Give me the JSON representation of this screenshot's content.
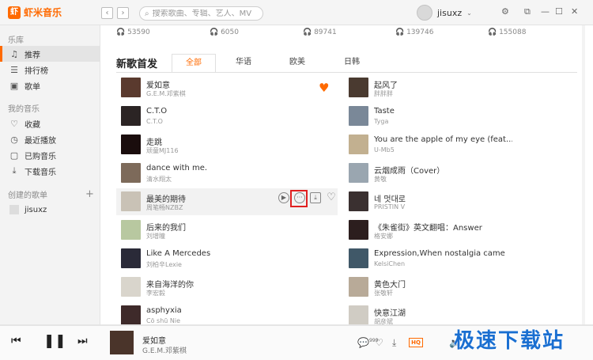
{
  "app": {
    "name": "虾米音乐",
    "logo_glyph": "虾"
  },
  "search": {
    "placeholder": "搜索歌曲、专辑、艺人、MV"
  },
  "user": {
    "name": "jisuxz"
  },
  "sidebar": {
    "library_label": "乐库",
    "library": [
      {
        "label": "推荐",
        "icon": "music-note-icon",
        "active": true
      },
      {
        "label": "排行榜",
        "icon": "chart-icon"
      },
      {
        "label": "歌单",
        "icon": "playlist-icon"
      }
    ],
    "my_music_label": "我的音乐",
    "my_music": [
      {
        "label": "收藏",
        "icon": "heart-icon"
      },
      {
        "label": "最近播放",
        "icon": "clock-icon"
      },
      {
        "label": "已购音乐",
        "icon": "bag-icon"
      },
      {
        "label": "下载音乐",
        "icon": "download-icon"
      }
    ],
    "created_label": "创建的歌单",
    "created": [
      {
        "label": "jisuxz"
      }
    ]
  },
  "stats": [
    "53590",
    "6050",
    "89741",
    "139746",
    "155088"
  ],
  "section": {
    "title": "新歌首发"
  },
  "tabs": [
    {
      "label": "全部",
      "active": true
    },
    {
      "label": "华语"
    },
    {
      "label": "欧美"
    },
    {
      "label": "日韩"
    }
  ],
  "songs_left": [
    {
      "title": "爱如意",
      "artist": "G.E.M.邓紫棋",
      "color": "#5a3a2e",
      "liked": true
    },
    {
      "title": "C.T.O",
      "artist": "C.T.O",
      "color": "#2b2424"
    },
    {
      "title": "走跳",
      "artist": "顽童MJ116",
      "color": "#1a0d0d"
    },
    {
      "title": "dance with me.",
      "artist": "清水翔太",
      "color": "#7d6a5a"
    },
    {
      "title": "最美的期待",
      "artist": "周笔畅NZBZ",
      "color": "#c9c2b6",
      "hover": true
    },
    {
      "title": "后来的我们",
      "artist": "刘增瞳",
      "color": "#b8c8a0"
    },
    {
      "title": "Like A Mercedes",
      "artist": "刘柏辛Lexie",
      "color": "#2a2a38"
    },
    {
      "title": "来自海洋的你",
      "artist": "李宏毅",
      "color": "#d9d5cc"
    },
    {
      "title": "asphyxia",
      "artist": "Cö shū Nie",
      "color": "#3e2a2a"
    }
  ],
  "songs_right": [
    {
      "title": "起风了",
      "artist": "胖胖胖",
      "color": "#4a3a30"
    },
    {
      "title": "Taste",
      "artist": "Tyga",
      "color": "#7a8898"
    },
    {
      "title": "You are the apple of my eye (feat....",
      "artist": "U-Mb5",
      "color": "#c2b090"
    },
    {
      "title": "云烟成雨（Cover）",
      "artist": "黄敬",
      "color": "#9aa6b0"
    },
    {
      "title": "네 멋대로",
      "artist": "PRISTIN V",
      "color": "#3a3030"
    },
    {
      "title": "《朱雀街》英文翻唱：Answer",
      "artist": "格安娜",
      "color": "#2c1e1e"
    },
    {
      "title": "Expression,When nostalgia came",
      "artist": "KelsiChen",
      "color": "#405868"
    },
    {
      "title": "黄色大门",
      "artist": "张敬轩",
      "color": "#b8aa98"
    },
    {
      "title": "快意江湖",
      "artist": "胡彦斌",
      "color": "#d0ccc4"
    }
  ],
  "player": {
    "title": "爱如意",
    "artist": "G.E.M.邓紫棋",
    "cover_color": "#4a342a",
    "comment_count": "999",
    "quality": "HQ",
    "progress": 0.0
  },
  "watermark": "极速下载站",
  "colors": {
    "accent": "#ff6a00",
    "highlight": "#e02020"
  }
}
